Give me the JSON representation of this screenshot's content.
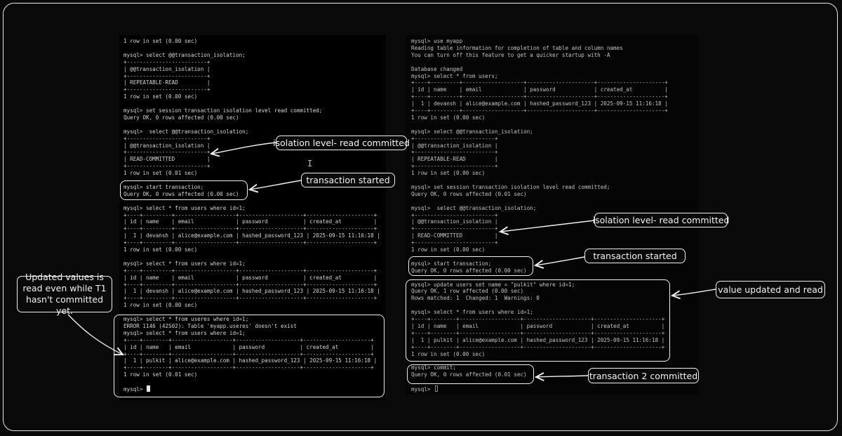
{
  "left_terminal": {
    "lines": [
      "1 row in set (0.00 sec)",
      "",
      "mysql> select @@transaction_isolation;",
      "+-------------------------+",
      "| @@transaction_isolation |",
      "+-------------------------+",
      "| REPEATABLE-READ         |",
      "+-------------------------+",
      "1 row in set (0.00 sec)",
      "",
      "mysql> set session transaction isolation level read committed;",
      "Query OK, 0 rows affected (0.00 sec)",
      "",
      "mysql>  select @@transaction_isolation;",
      "+-------------------------+",
      "| @@transaction_isolation |",
      "+-------------------------+",
      "| READ-COMMITTED          |",
      "+-------------------------+",
      "1 row in set (0.01 sec)",
      "",
      "mysql> start transaction;",
      "Query OK, 0 rows affected (0.00 sec)",
      "",
      "mysql> select * from users where id=1;",
      "+----+---------+-------------------+--------------------+---------------------+",
      "| id | name    | email             | password           | created_at          |",
      "+----+---------+-------------------+--------------------+---------------------+",
      "|  1 | devansh | alice@example.com | hashed_password_123 | 2025-09-15 11:16:18 |",
      "+----+---------+-------------------+--------------------+---------------------+",
      "1 row in set (0.00 sec)",
      "",
      "mysql> select * from users where id=1;",
      "+----+---------+-------------------+--------------------+---------------------+",
      "| id | name    | email             | password           | created_at          |",
      "+----+---------+-------------------+--------------------+---------------------+",
      "|  1 | devansh | alice@example.com | hashed_password_123 | 2025-09-15 11:16:18 |",
      "+----+---------+-------------------+--------------------+---------------------+",
      "1 row in set (0.00 sec)",
      "",
      "mysql> select * from useres where id=1;",
      "ERROR 1146 (42S02): Table 'myapp.useres' doesn't exist",
      "mysql> select * from users where id=1;",
      "+----+--------+-------------------+--------------------+---------------------+",
      "| id | name   | email             | password           | created_at          |",
      "+----+--------+-------------------+--------------------+---------------------+",
      "|  1 | pulkit | alice@example.com | hashed_password_123 | 2025-09-15 11:16:18 |",
      "+----+--------+-------------------+--------------------+---------------------+",
      "1 row in set (0.01 sec)",
      "",
      "mysql> "
    ]
  },
  "right_terminal": {
    "lines": [
      "mysql> use myapp",
      "Reading table information for completion of table and column names",
      "You can turn off this feature to get a quicker startup with -A",
      "",
      "Database changed",
      "mysql> select * from users;",
      "+----+---------+-------------------+---------------------+---------------------+",
      "| id | name    | email             | password            | created_at          |",
      "+----+---------+-------------------+---------------------+---------------------+",
      "|  1 | devansh | alice@example.com | hashed_password_123 | 2025-09-15 11:16:18 |",
      "+----+---------+-------------------+---------------------+---------------------+",
      "1 row in set (0.00 sec)",
      "",
      "mysql> select @@transaction_isolation;",
      "+-------------------------+",
      "| @@transaction_isolation |",
      "+-------------------------+",
      "| REPEATABLE-READ         |",
      "+-------------------------+",
      "1 row in set (0.00 sec)",
      "",
      "mysql> set session transaction isolation level read committed;",
      "Query OK, 0 rows affected (0.01 sec)",
      "",
      "mysql>  select @@transaction_isolation;",
      "+-------------------------+",
      "| @@transaction_isolation |",
      "+-------------------------+",
      "| READ-COMMITTED          |",
      "+-------------------------+",
      "1 row in set (0.00 sec)",
      "",
      "mysql> start transaction;",
      "Query OK, 0 rows affected (0.00 sec)",
      "",
      "mysql> update users set name = \"pulkit\" where id=1;",
      "Query OK, 1 row affected (0.00 sec)",
      "Rows matched: 1  Changed: 1  Warnings: 0",
      "",
      "mysql> select * from users where id=1;",
      "+----+--------+-------------------+---------------------+---------------------+",
      "| id | name   | email             | password            | created_at          |",
      "+----+--------+-------------------+---------------------+---------------------+",
      "|  1 | pulkit | alice@example.com | hashed_password_123 | 2025-09-15 11:16:18 |",
      "+----+--------+-------------------+---------------------+---------------------+",
      "1 row in set (0.00 sec)",
      "",
      "mysql> commit;",
      "Query OK, 0 rows affected (0.01 sec)",
      "",
      "mysql> "
    ]
  },
  "annotations": {
    "left_isolation": "isolation level- read committed",
    "left_transaction": "transaction started",
    "updated_values": "Updated values is read even while T1 hasn't committed yet.",
    "right_isolation": "isolation level- read committed",
    "right_transaction": "transaction started",
    "value_updated": "value updated and read",
    "transaction2": "transaction 2 committed"
  },
  "cursor_icons": [
    "block-cursor-icon",
    "hollow-cursor-icon",
    "text-ibeam-icon"
  ]
}
